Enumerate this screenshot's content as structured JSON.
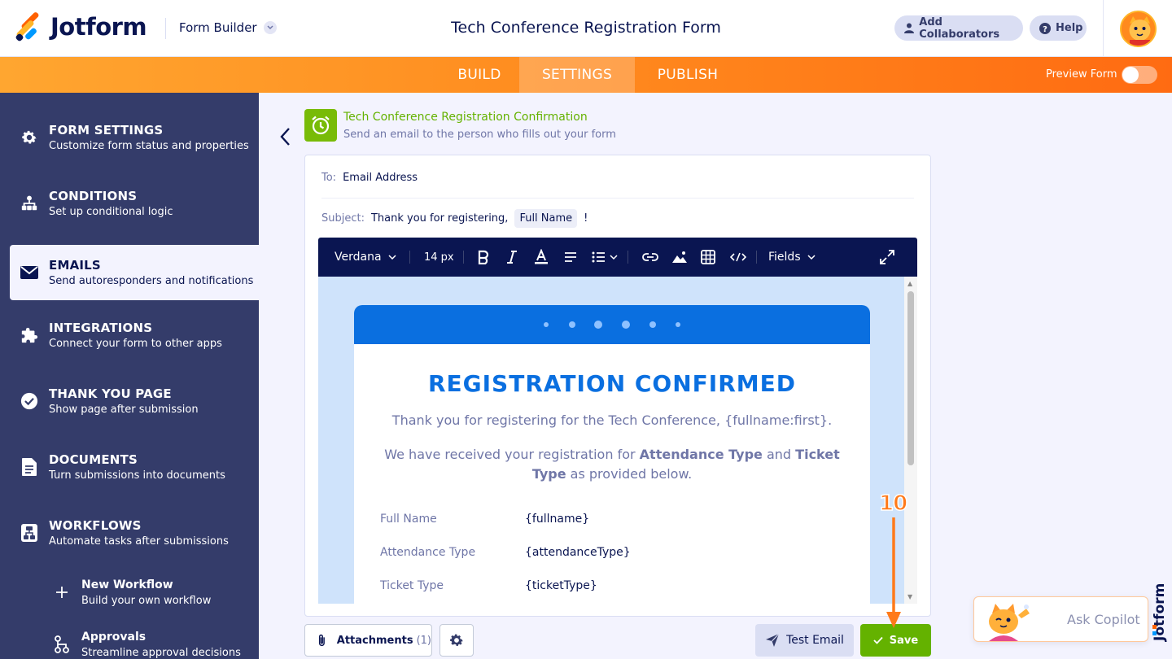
{
  "header": {
    "logo_text": "Jotform",
    "form_builder_label": "Form Builder",
    "form_title": "Tech Conference Registration Form",
    "add_collaborators_label": "Add Collaborators",
    "help_label": "Help"
  },
  "nav": {
    "tabs": [
      {
        "label": "BUILD"
      },
      {
        "label": "SETTINGS",
        "active": true
      },
      {
        "label": "PUBLISH"
      }
    ],
    "preview_label": "Preview Form",
    "preview_on": false
  },
  "sidebar": {
    "items": [
      {
        "title": "FORM SETTINGS",
        "subtitle": "Customize form status and properties",
        "icon": "gear-icon"
      },
      {
        "title": "CONDITIONS",
        "subtitle": "Set up conditional logic",
        "icon": "conditions-icon"
      },
      {
        "title": "EMAILS",
        "subtitle": "Send autoresponders and notifications",
        "icon": "envelope-icon",
        "active": true
      },
      {
        "title": "INTEGRATIONS",
        "subtitle": "Connect your form to other apps",
        "icon": "puzzle-icon"
      },
      {
        "title": "THANK YOU PAGE",
        "subtitle": "Show page after submission",
        "icon": "check-circle-icon"
      },
      {
        "title": "DOCUMENTS",
        "subtitle": "Turn submissions into documents",
        "icon": "document-icon"
      },
      {
        "title": "WORKFLOWS",
        "subtitle": "Automate tasks after submissions",
        "icon": "workflow-icon"
      }
    ],
    "sub_items": [
      {
        "title": "New Workflow",
        "subtitle": "Build your own workflow",
        "icon": "plus-icon"
      },
      {
        "title": "Approvals",
        "subtitle": "Streamline approval decisions",
        "icon": "approval-icon"
      }
    ]
  },
  "email": {
    "name": "Tech Conference Registration Confirmation",
    "description": "Send an email to the person who fills out your form",
    "to_label": "To:",
    "to_value": "Email Address",
    "subject_label": "Subject:",
    "subject_text": "Thank you for registering,",
    "subject_tag": "Full Name",
    "subject_end": "!"
  },
  "toolbar": {
    "font": "Verdana",
    "size": "14 px",
    "fields_label": "Fields"
  },
  "email_body": {
    "heading": "REGISTRATION CONFIRMED",
    "intro": "Thank you for registering for the Tech Conference, {fullname:first}.",
    "received_pre": "We have received your registration for",
    "received_b1": "Attendance Type",
    "received_and": "and",
    "received_b2": "Ticket Type",
    "received_post": "as provided below.",
    "rows": [
      {
        "label": "Full Name",
        "value": "{fullname}"
      },
      {
        "label": "Attendance Type",
        "value": "{attendanceType}"
      },
      {
        "label": "Ticket Type",
        "value": "{ticketType}"
      }
    ]
  },
  "bottom": {
    "attachments_label": "Attachments",
    "attachments_count": "(1)",
    "test_email_label": "Test Email",
    "save_label": "Save"
  },
  "annotation": {
    "step_number": "10",
    "color": "#ff7a1a"
  },
  "copilot": {
    "label": "Ask Copilot"
  },
  "colors": {
    "brand_orange": "#ff6100",
    "sidebar_bg": "#343c6a",
    "email_blue": "#0a6fe0",
    "save_green": "#64b200",
    "toolbar_navy": "#0a1551"
  }
}
